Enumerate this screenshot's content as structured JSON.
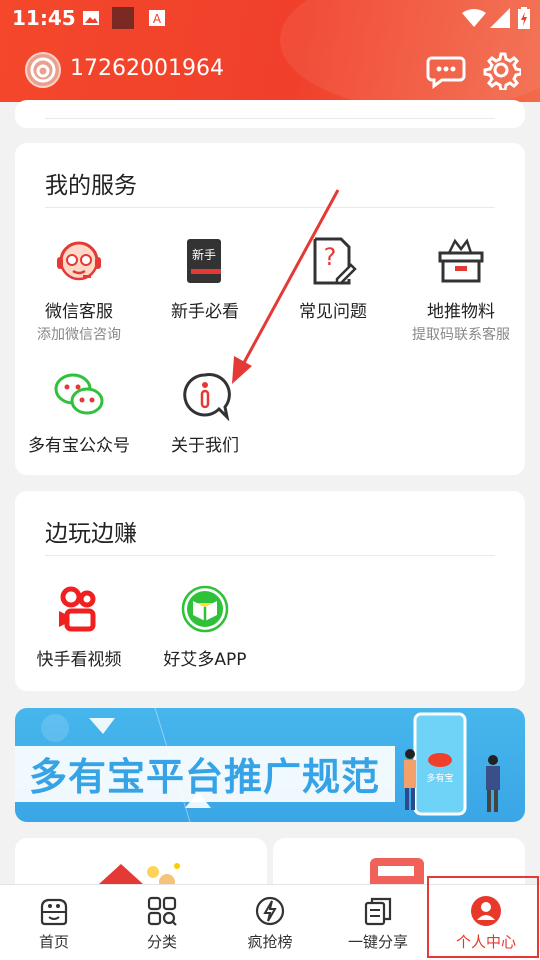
{
  "status_bar": {
    "time": "11:45"
  },
  "header": {
    "phone": "17262001964"
  },
  "services": {
    "title": "我的服务",
    "items": [
      {
        "label": "微信客服",
        "sub": "添加微信咨询"
      },
      {
        "label": "新手必看",
        "sub": ""
      },
      {
        "label": "常见问题",
        "sub": ""
      },
      {
        "label": "地推物料",
        "sub": "提取码联系客服"
      },
      {
        "label": "多有宝公众号",
        "sub": ""
      },
      {
        "label": "关于我们",
        "sub": ""
      }
    ]
  },
  "earn": {
    "title": "边玩边赚",
    "items": [
      {
        "label": "快手看视频"
      },
      {
        "label": "好艾多APP"
      }
    ]
  },
  "banner": {
    "text": "多有宝平台推广规范",
    "phone_label": "多有宝"
  },
  "icons": {
    "newbie_text": "新手"
  },
  "tabbar": {
    "tabs": [
      {
        "label": "首页"
      },
      {
        "label": "分类"
      },
      {
        "label": "疯抢榜"
      },
      {
        "label": "一键分享"
      },
      {
        "label": "个人中心"
      }
    ],
    "active_color": "#e8382a"
  },
  "colors": {
    "header_red": "#f0402b",
    "accent_red": "#e53935",
    "green": "#2fc13a"
  }
}
